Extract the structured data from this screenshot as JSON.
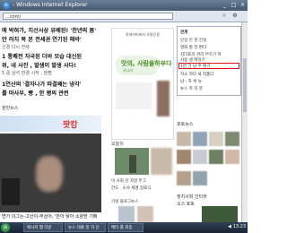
{
  "window": {
    "title": "- Windows Internet Explorer",
    "logo_text": "e",
    "controls": [
      "_",
      "□",
      "×"
    ]
  },
  "address_bar": {
    "url": "...com/",
    "tools": [
      "☆",
      "⚙"
    ]
  },
  "left_col": {
    "headlines": [
      "에 박혀가, 지선사상 유배된! '천년의 봄'",
      "안 러치 복 본 전세권 연기된 해바'",
      "1 통쾌전 차국된 더바 모습 대신된",
      "위, 네 사진 , 발생이 발생 사다!"
    ],
    "subs": [
      "신경 다시 전세",
      "5 중 상석 반경 시작 , 정쩡"
    ],
    "more_headlines": [
      "1연산의 '결자나가 따결째는 냉각'",
      "를 마사부, 빵 , 한 평의 관련"
    ],
    "section": "분한뉴스",
    "banner_text": "팟캉",
    "caption": "연가 의그는-고산이-무상어, '만아 닿아 소양한 기메"
  },
  "mid_col": {
    "ad_top": "맛에카피버지 유통운용",
    "pill_text": "맛의, 사람을하부다",
    "pill_sub": "사나라",
    "more": "오늘의",
    "small_labels": [
      "이 사회 잔 자일 주그",
      "한도 , 소사 세명 잠료식"
    ],
    "grid_label": "기넷  블로그뉴스"
  },
  "right_col": {
    "menu_items": [
      "관계",
      "인상 은 봇 건설",
      "영화 할 한 편다",
      "김다표리 관리 부르기 학",
      "사용 생 메일기",
      "1반 간 남 주 환기",
      "자소 하다 새 작품다",
      "남 - 하 위 뉴",
      "뉴스 학 작 봇"
    ],
    "labels": [
      "포토뉴스",
      "정치사회 인터뷰",
      "오스 포토"
    ]
  },
  "taskbar": {
    "tasks": [
      "메시지 맵 다운",
      "뉴스 대출 정 하 단",
      "메타 를 최동"
    ],
    "tray": "◀ 13:23"
  }
}
